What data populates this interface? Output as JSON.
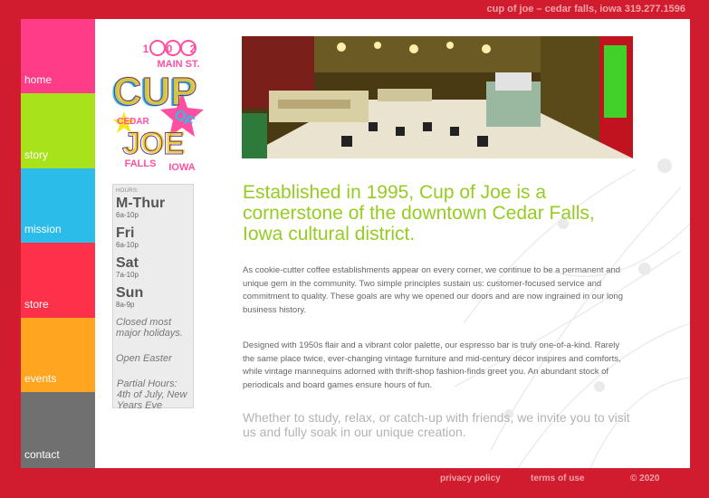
{
  "header": {
    "contact_line": "cup of joe – cedar falls, iowa 319.277.1596"
  },
  "nav": {
    "items": [
      {
        "label": "home",
        "color": "#ff3c87"
      },
      {
        "label": "story",
        "color": "#a7e21b"
      },
      {
        "label": "mission",
        "color": "#2bbcea"
      },
      {
        "label": "store",
        "color": "#ff3049"
      },
      {
        "label": "events",
        "color": "#ffa51f"
      },
      {
        "label": "contact",
        "color": "#707070"
      }
    ]
  },
  "logo": {
    "number": "1 0 2",
    "street": "MAIN ST.",
    "word1": "CUP",
    "word2": "OF",
    "word3": "JOE",
    "city": "CEDAR",
    "town": "FALLS",
    "state": "IOWA"
  },
  "hours": {
    "label": "HOURS:",
    "entries": [
      {
        "day": "M-Thur",
        "time": "6a-10p"
      },
      {
        "day": "Fri",
        "time": "6a-10p"
      },
      {
        "day": "Sat",
        "time": "7a-10p"
      },
      {
        "day": "Sun",
        "time": "8a-9p"
      }
    ],
    "note1": "Closed most major holidays.",
    "note2": "Open Easter",
    "note3": "Partial Hours: 4th of July, New Years Eve"
  },
  "main": {
    "headline": "Established in 1995, Cup of Joe is a cornerstone of the downtown Cedar Falls, Iowa cultural district.",
    "paragraph1": "As cookie-cutter coffee establishments appear on every corner, we continue to be a permanent and unique gem in the community. Two simple principles sustain us: customer-focused service and commitment to quality. These goals are why we opened our doors and are now ingrained in our long business history.",
    "paragraph2": "Designed with 1950s flair and a vibrant color palette, our espresso bar is truly one-of-a-kind. Rarely the same place twice, ever-changing vintage furniture and mid-century décor inspires and comforts, while vintage mannequins adorned with thrift-shop fashion-finds greet you. An abundant stock of periodicals and board games ensure hours of fun.",
    "closing": "Whether to study, relax, or catch-up with friends, we invite you to visit us and fully soak in our unique creation."
  },
  "footer": {
    "privacy": "privacy policy",
    "terms": "terms of use",
    "copyright": "© 2020"
  },
  "colors": {
    "brand_red": "#d01c2e",
    "headline_green": "#96cc22"
  }
}
